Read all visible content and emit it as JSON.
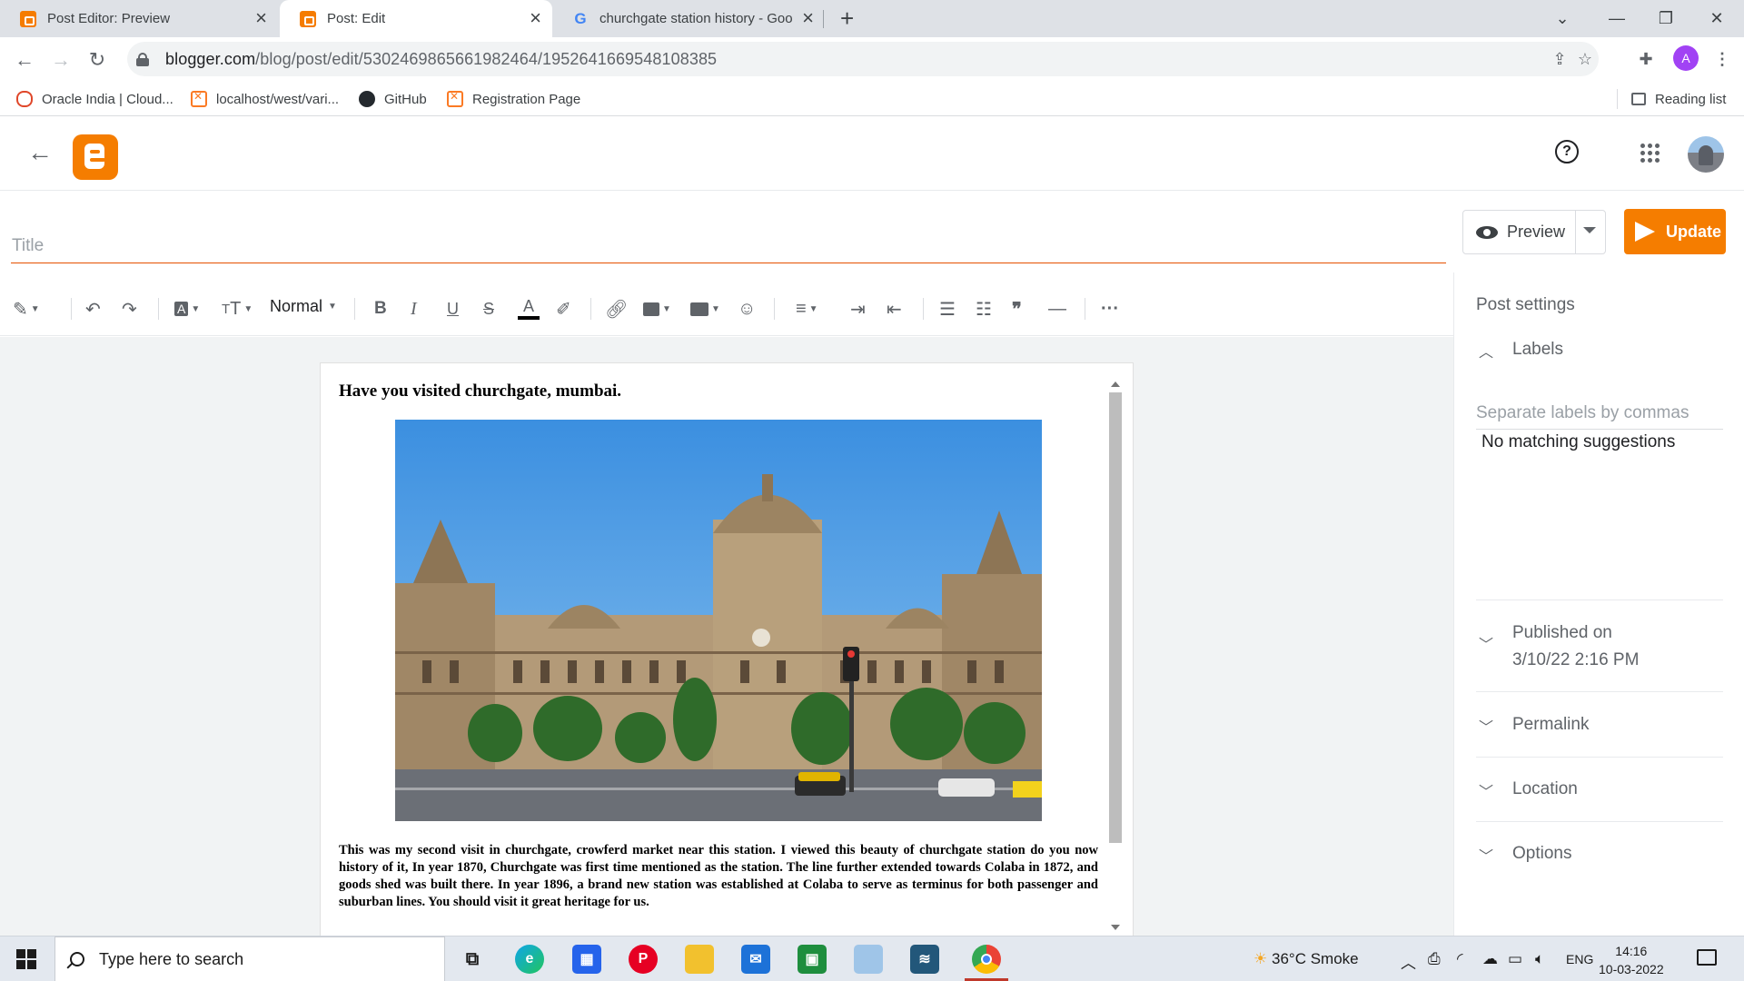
{
  "browser": {
    "tabs": [
      {
        "title": "Post Editor: Preview",
        "favicon": "blogger-icon",
        "active": false
      },
      {
        "title": "Post: Edit",
        "favicon": "blogger-icon",
        "active": true
      },
      {
        "title": "churchgate station history - Goo",
        "favicon": "google-icon",
        "active": false
      }
    ],
    "url_host": "blogger.com",
    "url_path": "/blog/post/edit/5302469865661982464/1952641669548108385",
    "bookmarks": [
      {
        "label": "Oracle India | Cloud...",
        "icon": "oracle-icon"
      },
      {
        "label": "localhost/west/vari...",
        "icon": "xampp-icon"
      },
      {
        "label": "GitHub",
        "icon": "github-icon"
      },
      {
        "label": "Registration Page",
        "icon": "xampp-icon"
      }
    ],
    "reading_list": "Reading list",
    "profile_initial": "A"
  },
  "editor": {
    "title_placeholder": "Title",
    "preview_label": "Preview",
    "update_label": "Update",
    "paragraph_style": "Normal",
    "accent_color": "#f57d00"
  },
  "document": {
    "heading": "Have you visited churchgate, mumbai.",
    "body": "This was my second visit in churchgate, crowferd market near this station. I viewed this beauty of churchgate station do you now history of it, In year 1870, Churchgate was first time mentioned as the station. The line further extended towards Colaba in 1872, and goods shed was built there. In year 1896, a brand new station was established at Colaba to serve as terminus for both passenger and suburban lines. You should visit it great heritage for us."
  },
  "sidebar": {
    "title": "Post settings",
    "labels_heading": "Labels",
    "labels_placeholder": "Separate labels by commas",
    "no_match": "No matching suggestions",
    "published_heading": "Published on",
    "published_value": "3/10/22 2:16 PM",
    "permalink": "Permalink",
    "location": "Location",
    "options": "Options"
  },
  "taskbar": {
    "search_placeholder": "Type here to search",
    "weather": "36°C  Smoke",
    "language": "ENG",
    "time": "14:16",
    "date": "10-03-2022"
  }
}
